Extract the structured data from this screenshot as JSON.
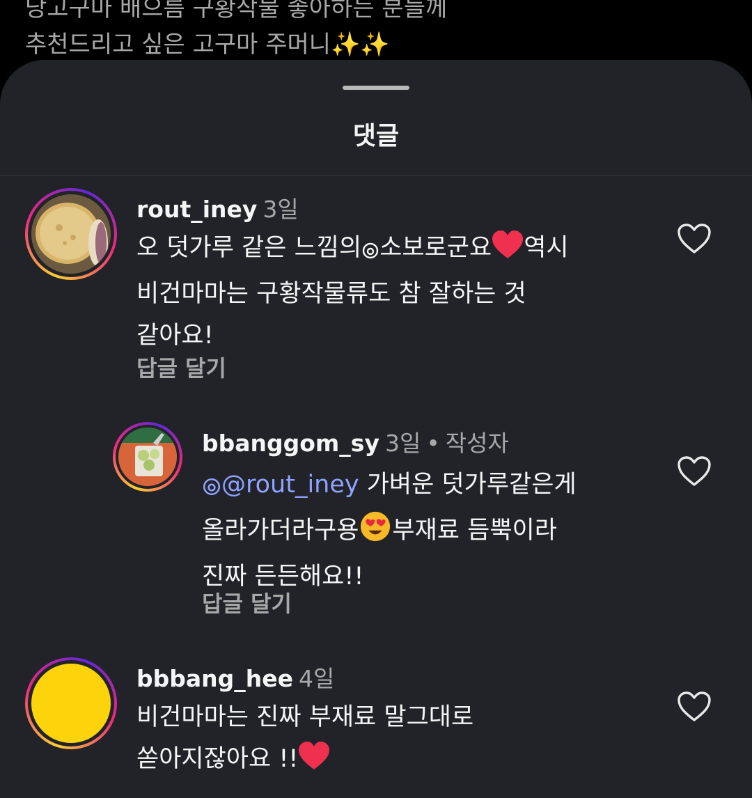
{
  "background_caption": {
    "line1": "추천드리고 싶은 고구마 주머니✨✨",
    "line0": "당고구마 배으름 구황작물 좋아하는 분들께"
  },
  "sheet": {
    "title": "댓글"
  },
  "comments": [
    {
      "username": "rout_iney",
      "time": "3일",
      "text_a": "오 덧가루 같은 느낌의",
      "text_b": "소보로군요",
      "text_c": "역시",
      "line2": "비건마마는 구황작물류도 참 잘하는 것",
      "line3": "같아요!",
      "reply_label": "답글 달기"
    },
    {
      "username": "bbanggom_sy",
      "time": "3일",
      "author_badge": "작성자",
      "mention": "@rout_iney",
      "text_a": "가벼운 덧가루같은게",
      "line2a": "올라가더라구용",
      "line2b": "부재료 듬뿍이라",
      "line3": "진짜 든든해요!!",
      "reply_label": "답글 달기"
    },
    {
      "username": "bbbang_hee",
      "time": "4일",
      "line1": "비건마마는 진짜 부재료 말그대로",
      "line2": "쏟아지잖아요 !!"
    }
  ],
  "icons": {
    "like": "heart-outline-icon",
    "emoji_heart": "red-heart-emoji",
    "emoji_heart_eyes": "heart-eyes-emoji",
    "emoji_sparkles": "sparkles-emoji",
    "threads_at": "threads-at-icon"
  },
  "colors": {
    "sheet_bg": "#212328",
    "mention": "#8fa2ff",
    "muted": "#a8a8a8"
  }
}
